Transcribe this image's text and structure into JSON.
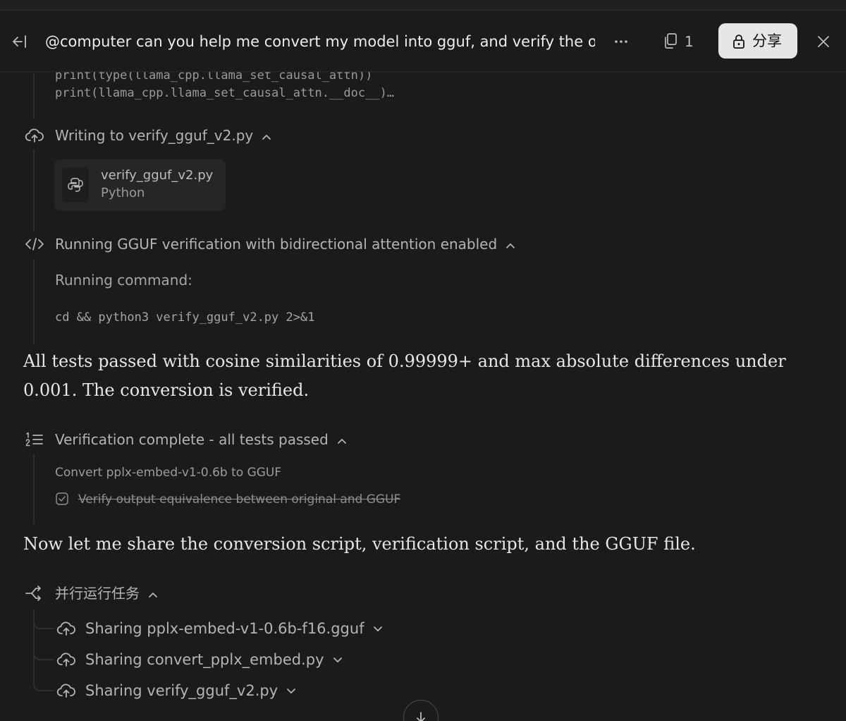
{
  "header": {
    "title": "@computer can you help me convert my model into gguf, and verify the out...",
    "copies_count": "1",
    "share_label": "分享"
  },
  "code_preview": {
    "line1": "print(type(llama_cpp.llama_set_causal_attn))",
    "line2": "print(llama_cpp.llama_set_causal_attn.__doc__)…"
  },
  "write_step": {
    "title": "Writing to verify_gguf_v2.py",
    "file_name": "verify_gguf_v2.py",
    "file_type": "Python"
  },
  "run_step": {
    "title": "Running GGUF verification with bidirectional attention enabled",
    "label": "Running command:",
    "command": "cd  && python3 verify_gguf_v2.py 2>&1"
  },
  "message1": "All tests passed with cosine similarities of 0.99999+ and max absolute differences under 0.001. The conversion is verified.",
  "todo_step": {
    "title": "Verification complete - all tests passed",
    "items": [
      {
        "text": "Convert pplx-embed-v1-0.6b to GGUF",
        "done": false
      },
      {
        "text": "Verify output equivalence between original and GGUF",
        "done": true
      }
    ]
  },
  "message2": "Now let me share the conversion script, verification script, and the GGUF file.",
  "parallel_step": {
    "title": "并行运行任务",
    "tasks": [
      {
        "label": "Sharing pplx-embed-v1-0.6b-f16.gguf"
      },
      {
        "label": "Sharing convert_pplx_embed.py"
      },
      {
        "label": "Sharing verify_gguf_v2.py"
      }
    ]
  },
  "icons": {
    "collapse": "collapse-panel-icon",
    "more": "more-horizontal-icon",
    "copies": "copy-documents-icon",
    "share_lock": "lock-icon",
    "close": "close-icon",
    "write": "cloud-upload-icon",
    "file": "python-icon",
    "run": "code-icon",
    "todo": "numbered-list-icon",
    "check": "checkbox-checked-icon",
    "parallel": "parallel-branch-icon",
    "share_task": "cloud-upload-icon",
    "chevron_up": "chevron-up-icon",
    "chevron_down": "chevron-down-icon",
    "scroll": "arrow-down-icon"
  },
  "colors": {
    "background": "#1b1b1b",
    "share_button_bg": "#e6e6e6",
    "text_primary": "#e6e6e6",
    "text_secondary": "#b4b4b4"
  }
}
